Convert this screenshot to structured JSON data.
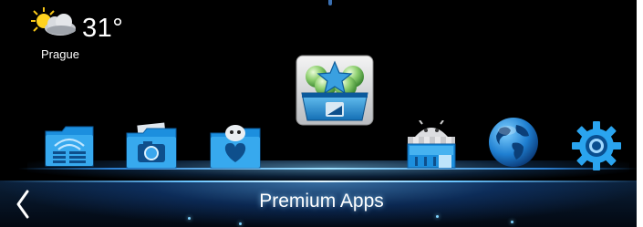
{
  "weather": {
    "temperature": "31°",
    "city": "Prague",
    "icon": "sun-cloud-icon"
  },
  "apps": [
    {
      "name": "file-manager-app",
      "icon": "wifi-folder-icon"
    },
    {
      "name": "photos-app",
      "icon": "camera-folder-icon"
    },
    {
      "name": "favorites-app",
      "icon": "heart-folder-icon"
    },
    {
      "name": "premium-apps-store",
      "icon": "star-basket-icon"
    },
    {
      "name": "android-market-app",
      "icon": "android-store-icon"
    },
    {
      "name": "browser-app",
      "icon": "globe-icon"
    },
    {
      "name": "settings-app",
      "icon": "gear-icon"
    }
  ],
  "bottom_bar": {
    "title": "Premium Apps",
    "back_icon": "chevron-left-icon"
  },
  "colors": {
    "accent": "#2a9be8",
    "background": "#000000"
  }
}
